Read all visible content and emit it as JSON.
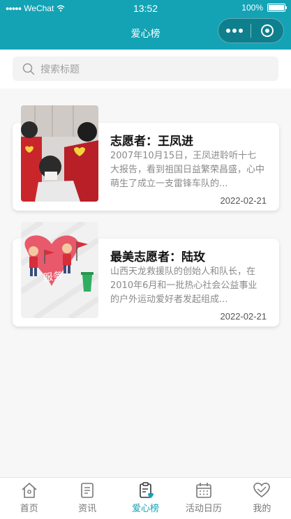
{
  "status_bar": {
    "carrier": "WeChat",
    "time": "13:52",
    "battery": "100%"
  },
  "nav": {
    "title": "爱心榜"
  },
  "search": {
    "placeholder": "搜索标题"
  },
  "articles": [
    {
      "title": "志愿者：王凤进",
      "excerpt": "2007年10月15日，王凤进聆听十七大报告，看到祖国日益繁荣昌盛，心中萌生了成立一支雷锋车队的...",
      "date": "2022-02-21"
    },
    {
      "title": "最美志愿者：陆玫",
      "excerpt": "山西天龙救援队的创始人和队长，在2010年6月和一批热心社会公益事业的户外运动爱好者发起组成...",
      "date": "2022-02-21"
    }
  ],
  "thumb2_text": "服务",
  "tabbar": {
    "items": [
      "首页",
      "资讯",
      "爱心榜",
      "活动日历",
      "我的"
    ],
    "active": "爱心榜"
  },
  "colors": {
    "brand": "#13a3b5",
    "heart": "#e8596b"
  }
}
